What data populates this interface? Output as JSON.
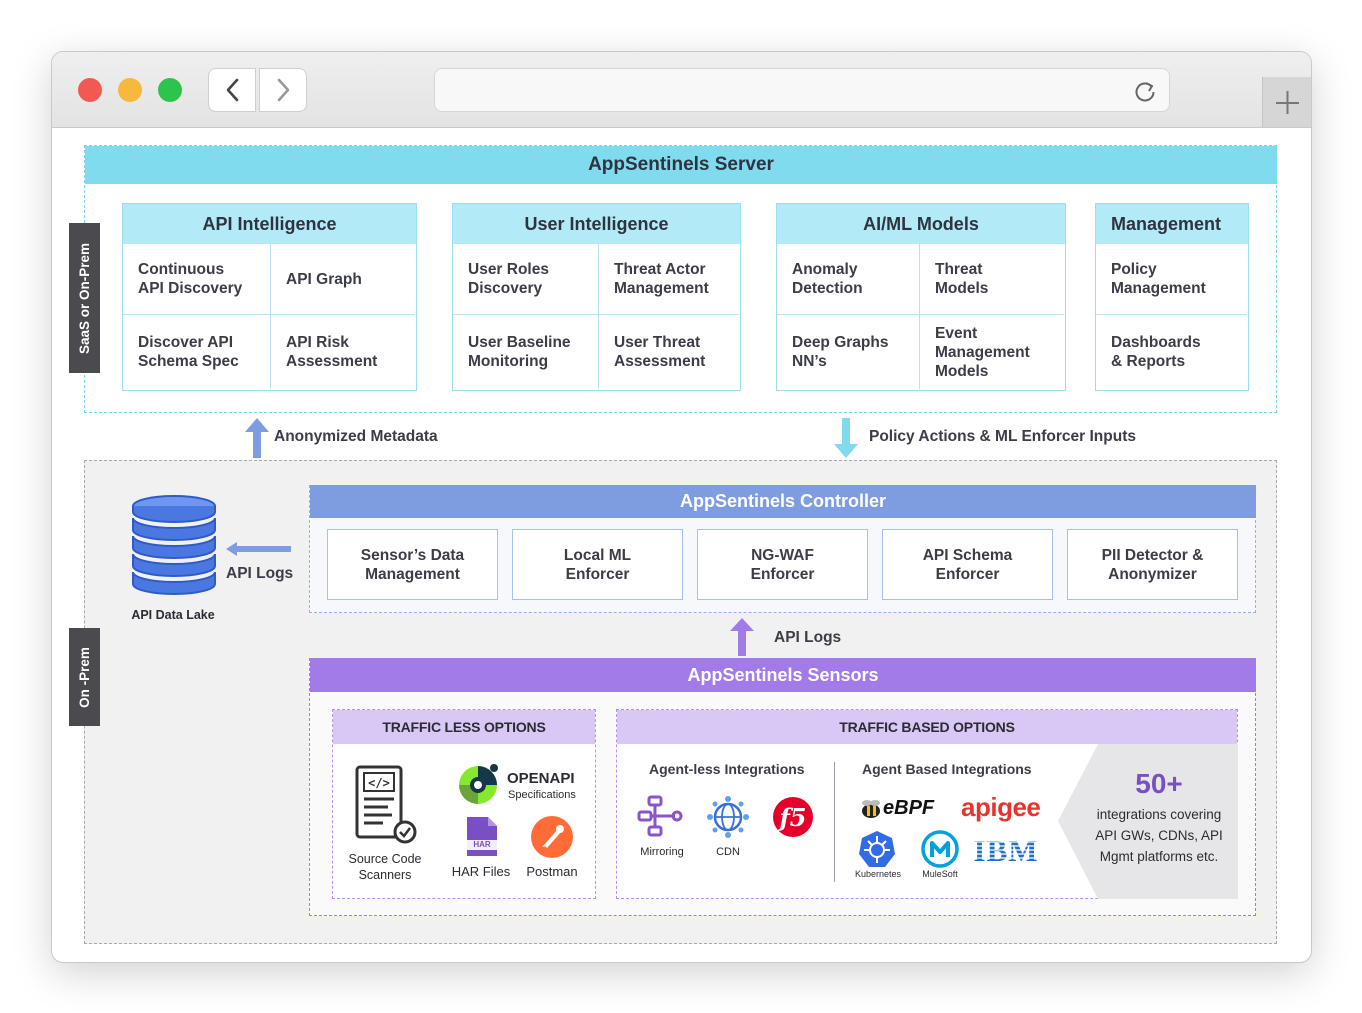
{
  "browser": {
    "controls": [
      "close",
      "minimize",
      "maximize"
    ],
    "url": "",
    "colors": {
      "close": "#f05a52",
      "minimize": "#f6b93b",
      "maximize": "#2dc44b"
    }
  },
  "server": {
    "title": "AppSentinels Server",
    "side_label": "SaaS or On-Prem",
    "groups": [
      {
        "title": "API Intelligence",
        "cells": [
          "Continuous\nAPI Discovery",
          "API Graph",
          "Discover API\nSchema Spec",
          "API Risk\nAssessment"
        ]
      },
      {
        "title": "User Intelligence",
        "cells": [
          "User Roles\nDiscovery",
          "Threat Actor\nManagement",
          "User Baseline\nMonitoring",
          "User Threat\nAssessment"
        ]
      },
      {
        "title": "AI/ML Models",
        "cells": [
          "Anomaly\nDetection",
          "Threat\nModels",
          "Deep Graphs\nNN’s",
          "Event\nManagement\nModels"
        ]
      },
      {
        "title": "Management",
        "cells": [
          "Policy\nManagement",
          "Dashboards\n& Reports"
        ]
      }
    ]
  },
  "flows": {
    "up": "Anonymized Metadata",
    "down": "Policy Actions & ML Enforcer Inputs",
    "logs_left": "API Logs",
    "logs_up": "API Logs"
  },
  "onprem": {
    "side_label": "On -Prem",
    "data_lake": "API Data Lake",
    "controller": {
      "title": "AppSentinels Controller",
      "items": [
        "Sensor’s Data\nManagement",
        "Local ML\nEnforcer",
        "NG-WAF\nEnforcer",
        "API Schema\nEnforcer",
        "PII Detector &\nAnonymizer"
      ]
    },
    "sensors": {
      "title": "AppSentinels Sensors",
      "traffic_less": {
        "title": "TRAFFIC LESS OPTIONS",
        "source_code": "Source Code\nScanners",
        "openapi_title": "OPENAPI",
        "openapi_sub": "Specifications",
        "har_badge": "HAR",
        "har": "HAR Files",
        "postman": "Postman"
      },
      "traffic_based": {
        "title": "TRAFFIC BASED OPTIONS",
        "agentless_title": "Agent-less Integrations",
        "agentless": [
          "Mirroring",
          "CDN"
        ],
        "f5": "f5",
        "agent_title": "Agent Based Integrations",
        "ebpf": "eBPF",
        "apigee": "apigee",
        "ibm": "IBM",
        "kubernetes": "Kubernetes",
        "mulesoft": "MuleSoft",
        "count": "50+",
        "count_text": "integrations covering\nAPI GWs, CDNs, API\nMgmt platforms etc."
      }
    }
  }
}
